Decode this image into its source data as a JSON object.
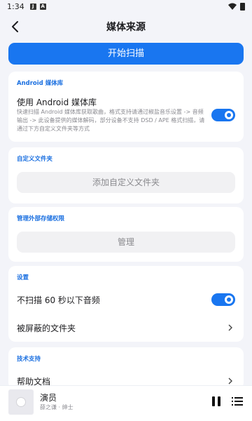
{
  "status_bar": {
    "time": "1:34",
    "icons": [
      "notification-j-icon",
      "notification-a-icon",
      "wifi-icon",
      "battery-icon"
    ],
    "badge_j": "J",
    "badge_a": "A"
  },
  "app_bar": {
    "title": "媒体来源",
    "back_icon": "back-arrow-icon"
  },
  "scan_button": {
    "label": "开始扫描"
  },
  "android_section": {
    "header": "Android 媒体库",
    "use_label": "使用 Android 媒体库",
    "use_description": "快速扫描 Android 媒体库获取歌曲，格式支持请通过椒盐音乐设置 -> 音频输出 -> 此设备提供的媒体解码，部分设备不支持 DSD / APE 格式扫描，请通过下方自定义文件夹等方式",
    "use_enabled": true
  },
  "custom_folders": {
    "header": "自定义文件夹",
    "add_button": "添加自定义文件夹"
  },
  "external_storage": {
    "header": "管理外部存储权限",
    "manage_button": "管理"
  },
  "settings": {
    "header": "设置",
    "skip_short_label": "不扫描 60 秒以下音频",
    "skip_short_enabled": true,
    "hidden_folders_label": "被屏蔽的文件夹"
  },
  "support": {
    "header": "技术支持",
    "help_docs_label": "帮助文档"
  },
  "player": {
    "title": "演员",
    "artist": "薛之谦 · 绅士",
    "pause_icon": "pause-icon",
    "queue_icon": "playlist-icon"
  },
  "colors": {
    "accent": "#1976f0",
    "background": "#f3f4f9",
    "card": "#ffffff"
  }
}
